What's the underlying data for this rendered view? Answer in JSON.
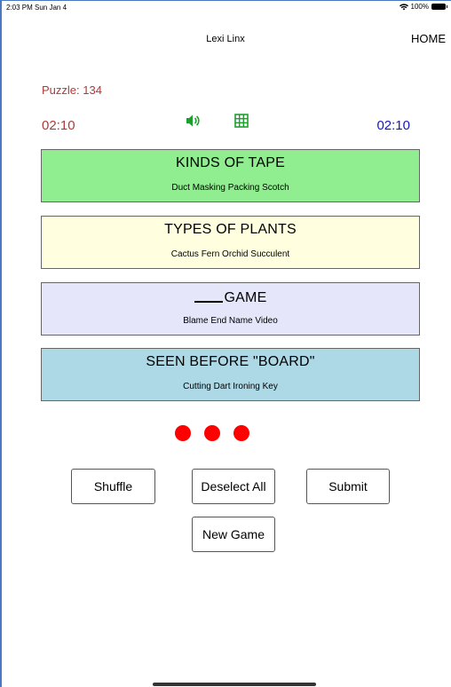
{
  "status_bar": {
    "time": "2:03 PM  Sun Jan 4",
    "battery": "100%",
    "icons": [
      "wifi-icon",
      "battery-icon"
    ]
  },
  "header": {
    "title": "Lexi Linx",
    "home_label": "HOME"
  },
  "puzzle": {
    "label": "Puzzle: 134"
  },
  "timers": {
    "left": "02:10",
    "right": "02:10"
  },
  "controls": {
    "icons": [
      "speaker-icon",
      "grid-icon"
    ]
  },
  "categories": [
    {
      "title": "KINDS OF TAPE",
      "words": "Duct  Masking  Packing  Scotch",
      "color": "#90ee90"
    },
    {
      "title": "TYPES OF PLANTS",
      "words": "Cactus  Fern  Orchid  Succulent",
      "color": "#ffffe0"
    },
    {
      "title": "GAME",
      "words": "Blame  End  Name  Video",
      "color": "#e6e6fa"
    },
    {
      "title": "SEEN BEFORE \"BOARD\"",
      "words": "Cutting  Dart  Ironing  Key",
      "color": "#add8e6"
    }
  ],
  "mistakes_remaining": 3,
  "buttons": {
    "shuffle": "Shuffle",
    "deselect_all": "Deselect All",
    "submit": "Submit",
    "new_game": "New Game"
  },
  "colors": {
    "timer_left": "#b03a3a",
    "timer_right": "#1515c8",
    "icon_green": "#1e9e2e",
    "dot_red": "#ff0000"
  }
}
